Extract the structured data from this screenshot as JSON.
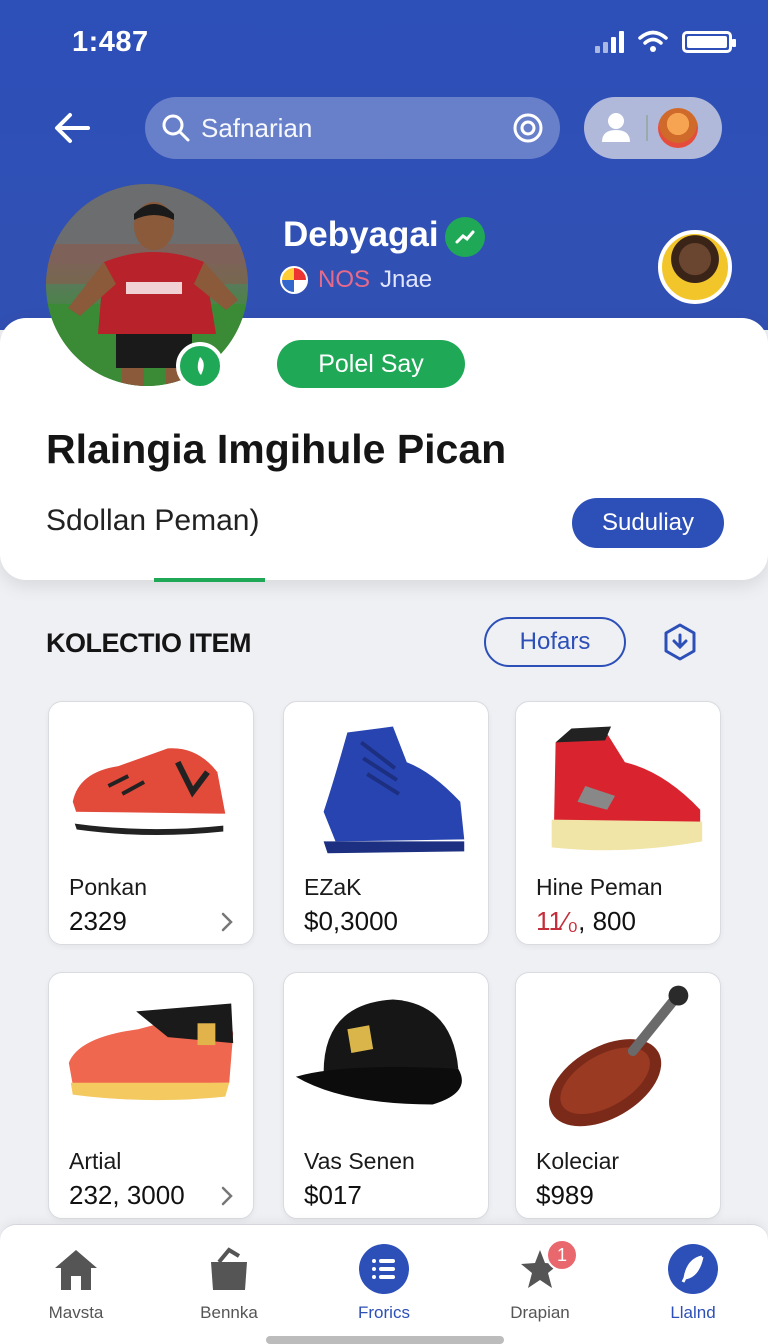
{
  "status_bar": {
    "time": "1:487"
  },
  "search": {
    "placeholder": "Safnarian"
  },
  "profile": {
    "name": "Debyagai",
    "tag": "NOS",
    "subname": "Jnae",
    "action_label": "Polel Say"
  },
  "card": {
    "title": "Rlaingia Imgihule Pican",
    "subtitle": "Sdollan Peman)",
    "button_label": "Suduliay"
  },
  "section": {
    "title": "KOLECTIO ITEM",
    "filter_label": "Hofars"
  },
  "items": [
    {
      "name": "Ponkan",
      "price": "2329",
      "image": "running-shoe-red"
    },
    {
      "name": "EZaK",
      "price": "$0,3000",
      "image": "boot-blue"
    },
    {
      "name": "Hine Peman",
      "price_red": "11⁄₀",
      "price_rest": ", 800",
      "image": "hightop-red"
    },
    {
      "name": "Artial",
      "price": "232, 3000",
      "image": "shoe-coral"
    },
    {
      "name": "Vas Senen",
      "price": "$017",
      "image": "cap-black"
    },
    {
      "name": "Koleciar",
      "price": "$989",
      "image": "wooden-paddle"
    }
  ],
  "bottom_nav": [
    {
      "label": "Mavsta",
      "icon": "home-icon"
    },
    {
      "label": "Bennka",
      "icon": "bag-icon"
    },
    {
      "label": "Frorics",
      "icon": "list-icon",
      "active": true
    },
    {
      "label": "Drapian",
      "icon": "star-icon",
      "badge": "1"
    },
    {
      "label": "Llalnd",
      "icon": "feather-icon"
    }
  ],
  "colors": {
    "primary": "#2d4fb8",
    "accent_green": "#1fa957",
    "badge_red": "#e8686e"
  }
}
